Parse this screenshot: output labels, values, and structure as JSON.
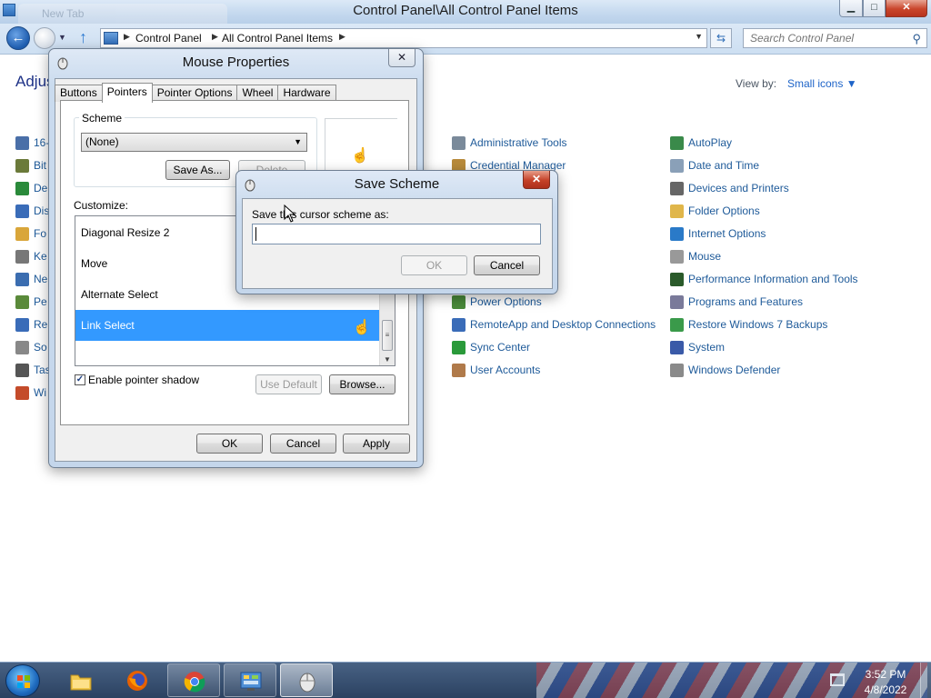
{
  "window": {
    "title": "Control Panel\\All Control Panel Items",
    "ghost_tab_title": "New Tab",
    "minimize_glyph": "▁",
    "maximize_glyph": "□",
    "close_glyph": "✕"
  },
  "address": {
    "back_glyph": "←",
    "recent_glyph": "▼",
    "up_glyph": "↑",
    "breadcrumbs": [
      "Control Panel",
      "All Control Panel Items"
    ],
    "separator_glyph": "▶",
    "dropdown_glyph": "▼",
    "refresh_glyph": "⇆",
    "search_placeholder": "Search Control Panel"
  },
  "control_panel": {
    "heading_partial": "Adjus",
    "view_by_label": "View by:",
    "view_by_value": "Small icons ▼",
    "left_column_partial": [
      {
        "label": "16-",
        "icon_color": "#4a6fa8",
        "icon": "chip-icon"
      },
      {
        "label": "Bit",
        "icon_color": "#6b7a3a",
        "icon": "bitlocker-icon"
      },
      {
        "label": "De",
        "icon_color": "#2a8a3a",
        "icon": "default-programs-icon"
      },
      {
        "label": "Dis",
        "icon_color": "#3a6cb8",
        "icon": "display-icon"
      },
      {
        "label": "Fo",
        "icon_color": "#d9a63a",
        "icon": "fonts-icon"
      },
      {
        "label": "Ke",
        "icon_color": "#777777",
        "icon": "keyboard-icon"
      },
      {
        "label": "Ne",
        "icon_color": "#3b6db0",
        "icon": "network-icon"
      },
      {
        "label": "Pe",
        "icon_color": "#5a8a3a",
        "icon": "personalization-icon"
      },
      {
        "label": "Re",
        "icon_color": "#3a6cb8",
        "icon": "recovery-icon"
      },
      {
        "label": "So",
        "icon_color": "#888888",
        "icon": "sound-icon"
      },
      {
        "label": "Tas",
        "icon_color": "#555555",
        "icon": "taskbar-icon"
      },
      {
        "label": "Wi",
        "icon_color": "#c44b2a",
        "icon": "windows-icon"
      }
    ],
    "middle_column": [
      {
        "label": "Administrative Tools",
        "icon_color": "#7a8a9a",
        "icon": "admin-tools-icon"
      },
      {
        "label": "Credential Manager",
        "icon_color": "#b88a3a",
        "icon": "credential-manager-icon"
      },
      {
        "label": "Power Options",
        "icon_color": "#4a8a3a",
        "icon": "power-icon"
      },
      {
        "label": "RemoteApp and Desktop Connections",
        "icon_color": "#3a6cb8",
        "icon": "remoteapp-icon"
      },
      {
        "label": "Sync Center",
        "icon_color": "#2a9a3a",
        "icon": "sync-icon"
      },
      {
        "label": "User Accounts",
        "icon_color": "#b07a4a",
        "icon": "user-accounts-icon"
      }
    ],
    "right_column": [
      {
        "label": "AutoPlay",
        "icon_color": "#3a8a4a",
        "icon": "autoplay-icon"
      },
      {
        "label": "Date and Time",
        "icon_color": "#8aa0b8",
        "icon": "clock-icon"
      },
      {
        "label": "Devices and Printers",
        "icon_color": "#666666",
        "icon": "printer-icon"
      },
      {
        "label": "Folder Options",
        "icon_color": "#e0b64a",
        "icon": "folder-icon"
      },
      {
        "label": "Internet Options",
        "icon_color": "#2a7ac8",
        "icon": "internet-icon"
      },
      {
        "label": "Mouse",
        "icon_color": "#999999",
        "icon": "mouse-icon"
      },
      {
        "label": "Performance Information and Tools",
        "icon_color": "#2a5a2a",
        "icon": "performance-icon"
      },
      {
        "label": "Programs and Features",
        "icon_color": "#7a7a9a",
        "icon": "programs-icon"
      },
      {
        "label": "Restore Windows 7 Backups",
        "icon_color": "#3a9a4a",
        "icon": "backup-icon"
      },
      {
        "label": "System",
        "icon_color": "#3a5aa8",
        "icon": "system-icon"
      },
      {
        "label": "Windows Defender",
        "icon_color": "#8a8a8a",
        "icon": "defender-icon"
      }
    ]
  },
  "mouse_properties": {
    "title": "Mouse Properties",
    "close_glyph": "✕",
    "tabs": [
      "Buttons",
      "Pointers",
      "Pointer Options",
      "Wheel",
      "Hardware"
    ],
    "active_tab": "Pointers",
    "scheme_label": "Scheme",
    "scheme_value": "(None)",
    "dropdown_glyph": "▼",
    "save_as_label": "Save As...",
    "delete_label": "Delete",
    "customize_label": "Customize:",
    "cursor_list": [
      "Diagonal Resize 2",
      "Move",
      "Alternate Select",
      "Link Select"
    ],
    "selected_cursor": "Link Select",
    "scroll_thumb_glyph": "≡",
    "scroll_down_glyph": "▼",
    "checkbox_glyph": "✓",
    "enable_shadow_label": "Enable pointer shadow",
    "enable_shadow_checked": true,
    "use_default_label": "Use Default",
    "browse_label": "Browse...",
    "ok_label": "OK",
    "cancel_label": "Cancel",
    "apply_label": "Apply"
  },
  "save_scheme": {
    "title": "Save Scheme",
    "close_glyph": "✕",
    "prompt": "Save this cursor scheme as:",
    "input_value": "",
    "ok_label": "OK",
    "cancel_label": "Cancel"
  },
  "taskbar": {
    "apps": [
      {
        "name": "explorer",
        "icon": "folder-icon",
        "state": "idle"
      },
      {
        "name": "firefox",
        "icon": "firefox-icon",
        "state": "idle"
      },
      {
        "name": "chrome",
        "icon": "chrome-icon",
        "state": "running"
      },
      {
        "name": "control-panel",
        "icon": "control-panel-icon",
        "state": "running"
      },
      {
        "name": "mouse-properties",
        "icon": "mouse-icon",
        "state": "active"
      }
    ],
    "time": "3:52 PM",
    "date": "4/8/2022"
  },
  "cursor_glyph": "☝"
}
